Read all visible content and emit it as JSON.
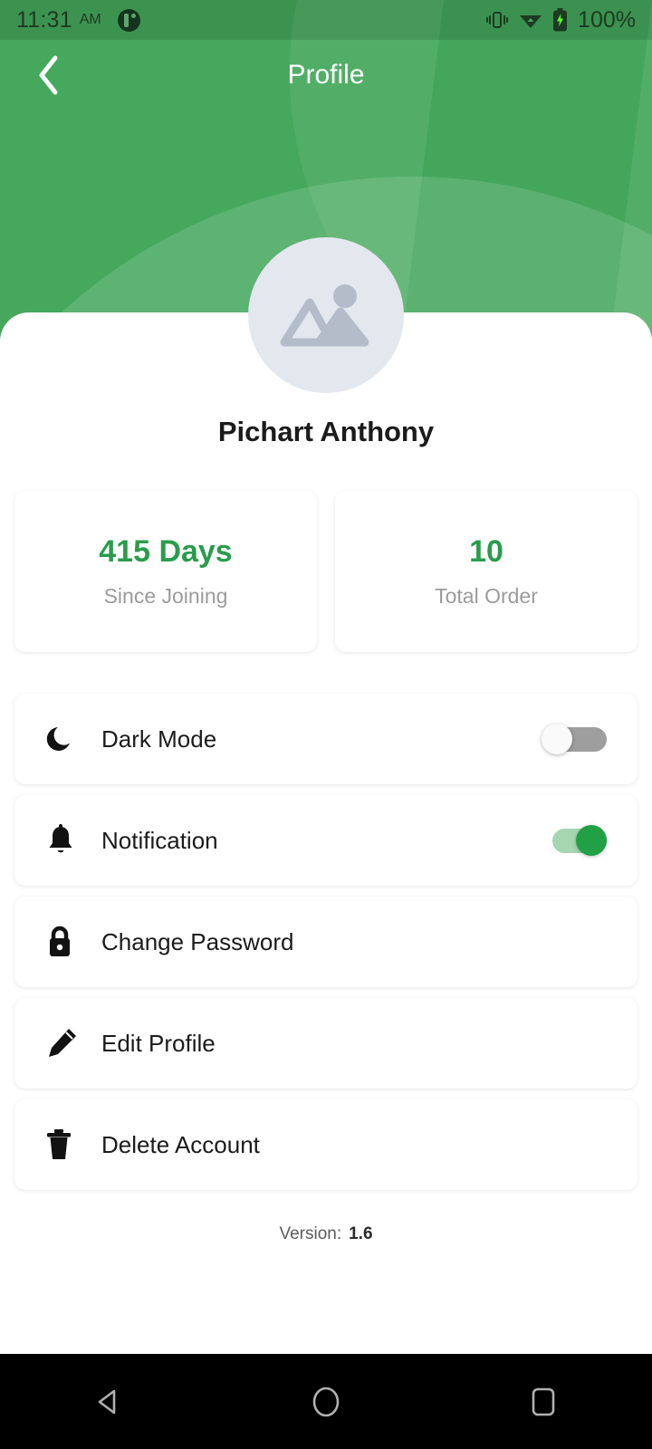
{
  "status_bar": {
    "time": "11:31",
    "ampm": "AM",
    "battery_percent": "100%",
    "icons": [
      "app-notification-icon",
      "vibrate-icon",
      "wifi-icon",
      "battery-charging-icon"
    ]
  },
  "app_bar": {
    "title": "Profile",
    "back_icon": "chevron-left-icon"
  },
  "profile": {
    "avatar_icon": "image-placeholder-icon",
    "name": "Pichart Anthony"
  },
  "stats": [
    {
      "value": "415 Days",
      "label": "Since Joining"
    },
    {
      "value": "10",
      "label": "Total Order"
    }
  ],
  "menu": [
    {
      "label": "Dark Mode",
      "icon": "moon-icon",
      "control": "toggle",
      "state": "off"
    },
    {
      "label": "Notification",
      "icon": "bell-icon",
      "control": "toggle",
      "state": "on"
    },
    {
      "label": "Change Password",
      "icon": "lock-icon",
      "control": "none",
      "state": ""
    },
    {
      "label": "Edit Profile",
      "icon": "pencil-icon",
      "control": "none",
      "state": ""
    },
    {
      "label": "Delete Account",
      "icon": "trash-icon",
      "control": "none",
      "state": ""
    }
  ],
  "footer": {
    "version_label": "Version:",
    "version_number": "1.6"
  },
  "nav_bar": {
    "back": "back-triangle-icon",
    "home": "home-circle-icon",
    "recents": "recents-square-icon"
  },
  "colors": {
    "brand_green": "#45a85c",
    "brand_green_dark": "#36a04f",
    "accent_green": "#2a9c4d",
    "toggle_on": "#22a045",
    "toggle_off_track": "#9e9e9e",
    "avatar_bg": "#e3e7ee",
    "muted_text": "#9b9b9b"
  }
}
